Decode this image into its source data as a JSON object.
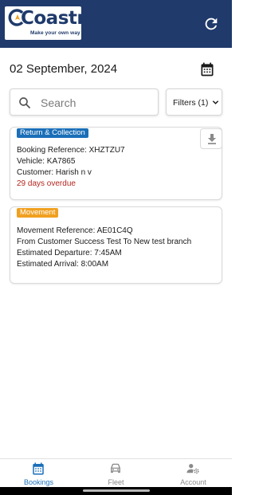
{
  "header": {
    "logo_text": "Coastr",
    "logo_tagline": "Make your own way",
    "refresh_icon": "refresh-icon",
    "background_color": "#1f3a6b"
  },
  "date_bar": {
    "date": "02 September, 2024",
    "calendar_icon": "calendar-icon"
  },
  "search": {
    "placeholder": "Search",
    "value": "",
    "icon": "search-icon"
  },
  "filters": {
    "label": "Filters (1)",
    "icon": "chevron-down-icon"
  },
  "cards": [
    {
      "tag": "Return & Collection",
      "tag_color": "#1b6fb8",
      "lines": [
        "Booking Reference: XHZTZU7",
        "Vehicle: KA7865",
        "Customer: Harish n v"
      ],
      "status": "29 days overdue",
      "status_color": "#b3261e",
      "action_icon": "download-icon"
    },
    {
      "tag": "Movement",
      "tag_color": "#f0a020",
      "lines": [
        "Movement Reference: AE01C4Q",
        "From Customer Success Test To New test branch",
        "Estimated Departure: 7:45AM",
        "Estimated Arrival: 8:00AM"
      ]
    }
  ],
  "bottom_nav": {
    "items": [
      {
        "label": "Bookings",
        "icon": "calendar-icon",
        "active": true
      },
      {
        "label": "Fleet",
        "icon": "car-icon",
        "active": false
      },
      {
        "label": "Account",
        "icon": "user-settings-icon",
        "active": false
      }
    ],
    "active_color": "#1b6fb8"
  }
}
